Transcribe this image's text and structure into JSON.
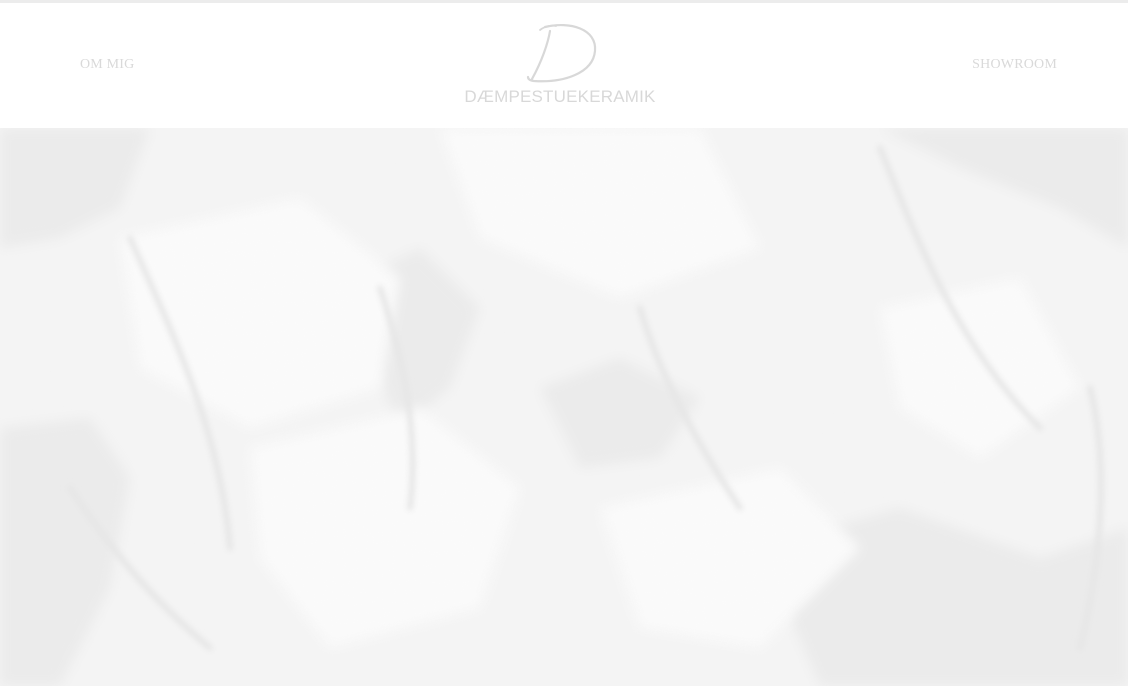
{
  "header": {
    "nav_left": {
      "label": "OM MIG"
    },
    "nav_right": {
      "label": "SHOWROOM"
    },
    "logo": {
      "monogram": "D",
      "wordmark": "DÆMPESTUEKERAMIK"
    }
  },
  "hero": {
    "image": "ceramic-texture-closeup"
  },
  "colors": {
    "background": "#ffffff",
    "nav_text": "#d9d9d9",
    "logo": "#d8d8d8",
    "hero_base": "#f4f4f4",
    "hero_shadow": "#e9e9e9",
    "hero_highlight": "#fbfbfb"
  }
}
